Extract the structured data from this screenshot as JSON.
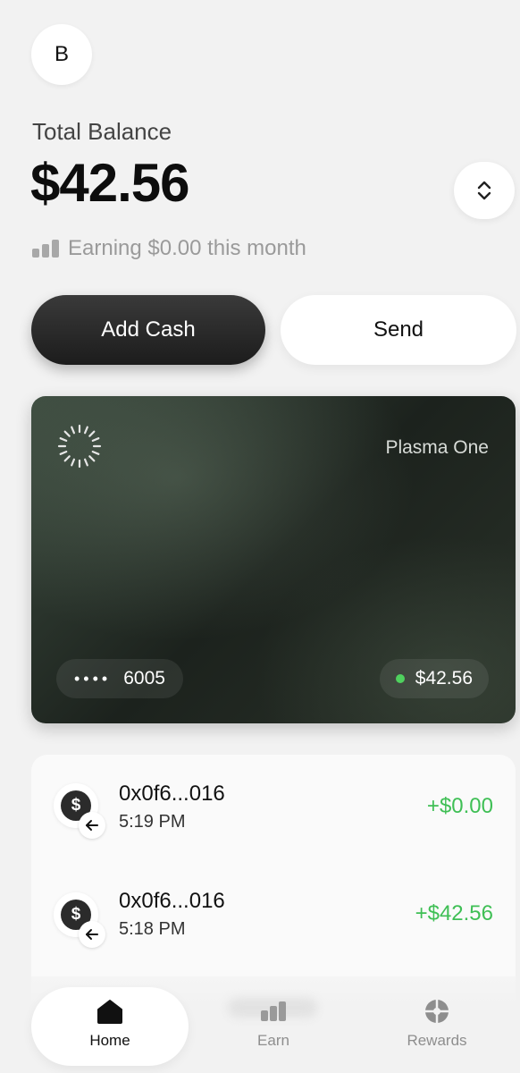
{
  "header": {
    "avatar_initial": "B",
    "total_label": "Total Balance",
    "balance": "$42.56",
    "earning_text": "Earning $0.00 this month"
  },
  "actions": {
    "add_cash": "Add Cash",
    "send": "Send"
  },
  "card": {
    "name": "Plasma One",
    "masked": "••••",
    "last4": "6005",
    "balance": "$42.56",
    "status_color": "#4fd15e"
  },
  "transactions": [
    {
      "address": "0x0f6...016",
      "time": "5:19 PM",
      "amount": "+$0.00",
      "icon": "dollar-icon",
      "direction": "incoming-arrow-icon"
    },
    {
      "address": "0x0f6...016",
      "time": "5:18 PM",
      "amount": "+$42.56",
      "icon": "dollar-icon",
      "direction": "incoming-arrow-icon"
    }
  ],
  "tabs": [
    {
      "label": "Home",
      "icon": "home-icon",
      "active": true
    },
    {
      "label": "Earn",
      "icon": "bar-chart-icon",
      "active": false
    },
    {
      "label": "Rewards",
      "icon": "rewards-icon",
      "active": false
    }
  ],
  "colors": {
    "positive": "#3fbf55",
    "primary_button": "#1c1c1c",
    "background": "#f2f2f2"
  }
}
